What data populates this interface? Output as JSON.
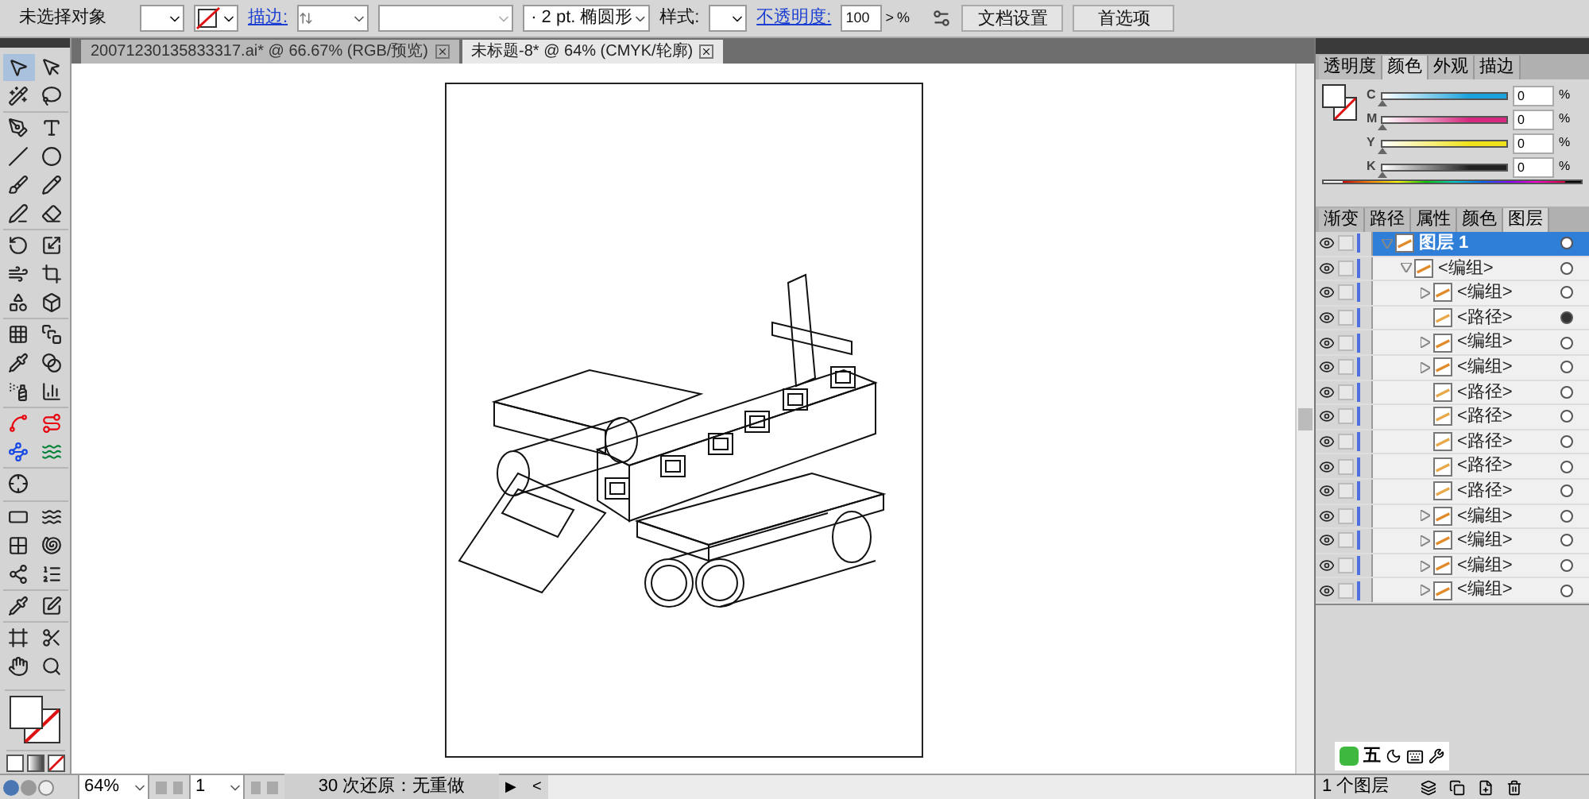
{
  "control_bar": {
    "selection": "未选择对象",
    "stroke_label": "描边:",
    "brush": "·  2 pt. 椭圆形",
    "style_label": "样式:",
    "opacity_label": "不透明度:",
    "opacity": "100",
    "opacity_arrow": ">",
    "percent": "%",
    "buttons": [
      "文档设置",
      "首选项"
    ]
  },
  "doc_tabs": [
    {
      "label": "20071230135833317.ai* @ 66.67% (RGB/预览)",
      "selected": false
    },
    {
      "label": "未标题-8* @ 64% (CMYK/轮廓)",
      "selected": true
    }
  ],
  "tools": [
    {
      "selected": true
    },
    {
      "selected": false
    },
    {
      "selected": false
    },
    {
      "selected": false
    },
    {
      "selected": false
    },
    {
      "selected": false
    },
    {
      "selected": false
    },
    {
      "selected": false
    },
    {
      "selected": false
    },
    {
      "selected": false
    },
    {
      "selected": false
    },
    {
      "selected": false
    },
    {
      "selected": false
    },
    {
      "selected": false
    },
    {
      "selected": false
    },
    {
      "selected": false
    },
    {
      "selected": false
    },
    {
      "selected": false
    },
    {
      "selected": false
    },
    {
      "selected": false
    },
    {
      "selected": false
    },
    {
      "selected": false
    },
    {
      "selected": false
    },
    {
      "selected": false
    },
    {
      "selected": false
    },
    {
      "selected": false
    },
    {
      "selected": false
    },
    {
      "selected": false
    },
    {
      "selected": false
    },
    {
      "selected": false
    },
    {
      "selected": false
    },
    {
      "selected": false
    },
    {
      "selected": false
    },
    {
      "selected": false
    },
    {
      "selected": false
    },
    {
      "selected": false
    },
    {
      "selected": false
    },
    {
      "selected": false
    },
    {
      "selected": false
    }
  ],
  "color_panel": {
    "tabs": [
      {
        "label": "透明度",
        "selected": false
      },
      {
        "label": "颜色",
        "selected": true
      },
      {
        "label": "外观",
        "selected": false
      },
      {
        "label": "描边",
        "selected": false
      }
    ],
    "channels": [
      {
        "name": "C",
        "value": "0",
        "unit": "%",
        "level": 0,
        "color": "#1aa3dd"
      },
      {
        "name": "M",
        "value": "0",
        "unit": "%",
        "level": 0,
        "color": "#d6297f"
      },
      {
        "name": "Y",
        "value": "0",
        "unit": "%",
        "level": 0,
        "color": "#f0e21a"
      },
      {
        "name": "K",
        "value": "0",
        "unit": "%",
        "level": 0,
        "color": "#222222"
      }
    ]
  },
  "layers_panel": {
    "tabs": [
      {
        "label": "渐变",
        "selected": false
      },
      {
        "label": "路径",
        "selected": false
      },
      {
        "label": "属性",
        "selected": false
      },
      {
        "label": "颜色",
        "selected": false
      },
      {
        "label": "图层",
        "selected": true
      }
    ],
    "layers": [
      {
        "name": "图层 1",
        "kind": "layer",
        "selected": true,
        "expanded": true,
        "targeted": false,
        "children": [
          {
            "name": "<编组>",
            "kind": "group",
            "selected": false,
            "expanded": true,
            "targeted": false,
            "children": [
              {
                "name": "<编组>",
                "kind": "group",
                "selected": false,
                "expanded": false,
                "targeted": false
              },
              {
                "name": "<路径>",
                "kind": "path",
                "selected": false,
                "targeted": true
              },
              {
                "name": "<编组>",
                "kind": "group",
                "selected": false,
                "expanded": false,
                "targeted": false
              },
              {
                "name": "<编组>",
                "kind": "group",
                "selected": false,
                "expanded": false,
                "targeted": false
              },
              {
                "name": "<路径>",
                "kind": "path",
                "selected": false,
                "targeted": false
              },
              {
                "name": "<路径>",
                "kind": "path",
                "selected": false,
                "targeted": false
              },
              {
                "name": "<路径>",
                "kind": "path",
                "selected": false,
                "targeted": false
              },
              {
                "name": "<路径>",
                "kind": "path",
                "selected": false,
                "targeted": false
              },
              {
                "name": "<路径>",
                "kind": "path",
                "selected": false,
                "targeted": false
              },
              {
                "name": "<编组>",
                "kind": "group",
                "selected": false,
                "expanded": false,
                "targeted": false
              },
              {
                "name": "<编组>",
                "kind": "group",
                "selected": false,
                "expanded": false,
                "targeted": false
              },
              {
                "name": "<编组>",
                "kind": "group",
                "selected": false,
                "expanded": false,
                "targeted": false
              },
              {
                "name": "<编组>",
                "kind": "group",
                "selected": false,
                "expanded": false,
                "targeted": false
              }
            ]
          }
        ]
      }
    ],
    "footer": "1 个图层"
  },
  "ime_bar": {
    "label": "五"
  },
  "status_bar": {
    "zoom": "64%",
    "page": "1",
    "message": "30 次还原：无重做",
    "play": "▶",
    "back": "<"
  }
}
